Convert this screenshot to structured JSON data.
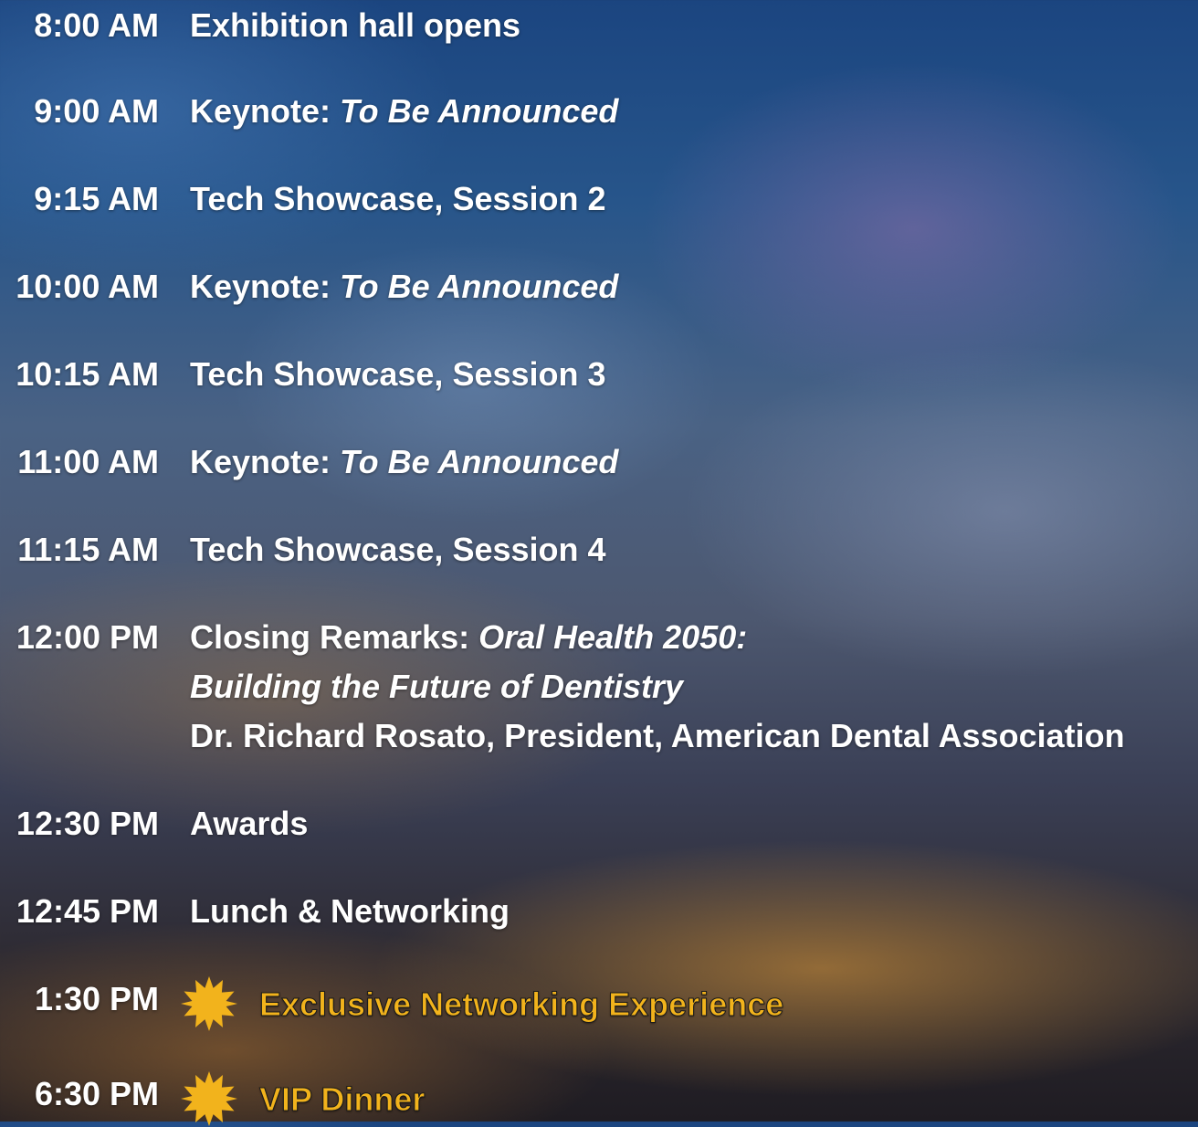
{
  "agenda": [
    {
      "time": "8:00 AM",
      "title": "Exhibition hall opens"
    },
    {
      "time": "9:00 AM",
      "prefix": "Keynote: ",
      "title_italic": "To Be Announced"
    },
    {
      "time": "9:15 AM",
      "title": "Tech Showcase, Session 2"
    },
    {
      "time": "10:00 AM",
      "prefix": "Keynote: ",
      "title_italic": "To Be Announced"
    },
    {
      "time": "10:15 AM",
      "title": "Tech Showcase, Session 3"
    },
    {
      "time": "11:00 AM",
      "prefix": "Keynote: ",
      "title_italic": "To Be Announced"
    },
    {
      "time": "11:15 AM",
      "title": "Tech Showcase, Session 4"
    },
    {
      "time": "12:00 PM",
      "prefix": "Closing Remarks: ",
      "title_italic": "Oral Health 2050:",
      "title_italic_2": "Building the Future of Dentistry",
      "speaker": "Dr. Richard Rosato, President, American Dental Association"
    },
    {
      "time": "12:30 PM",
      "title": "Awards"
    },
    {
      "time": "12:45 PM",
      "title": "Lunch & Networking"
    },
    {
      "time": "1:30 PM",
      "title": "Exclusive Networking Experience",
      "icon": "starburst-icon"
    },
    {
      "time": "6:30 PM",
      "title": "VIP Dinner",
      "icon": "starburst-icon"
    }
  ],
  "colors": {
    "text": "#ffffff",
    "highlight": "#f2b31c"
  }
}
